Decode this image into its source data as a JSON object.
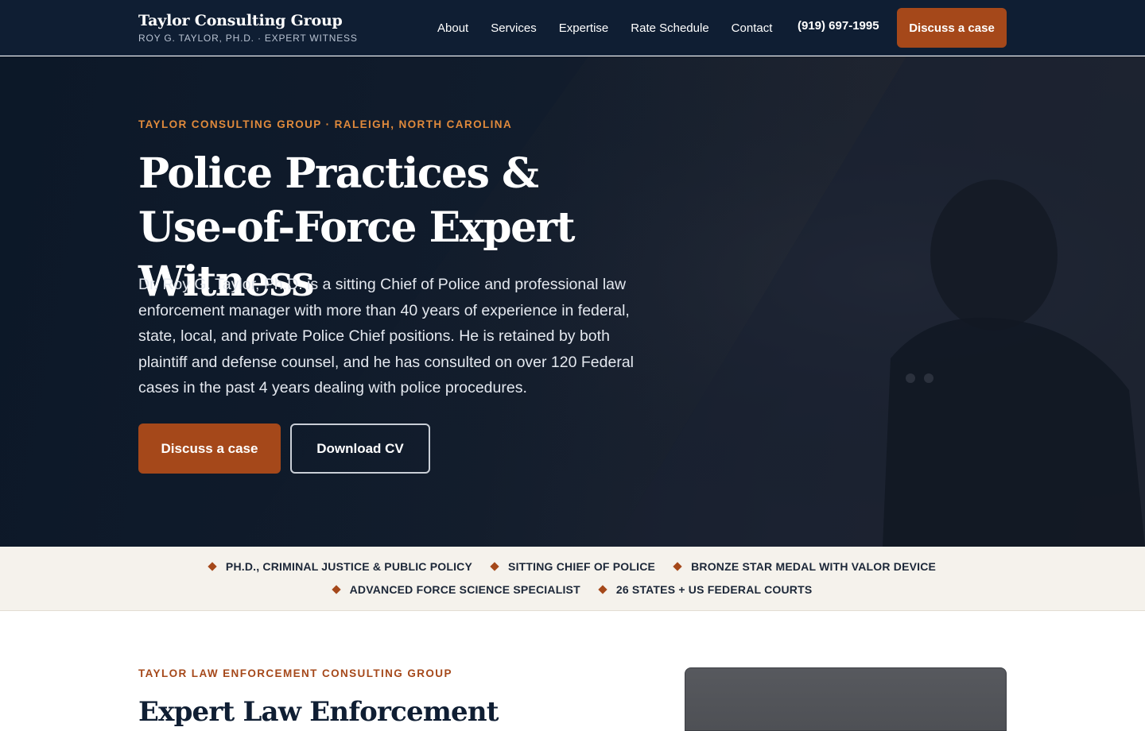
{
  "header": {
    "brand_name": "Taylor Consulting Group",
    "brand_sub": "ROY G. TAYLOR, PH.D. · EXPERT WITNESS",
    "nav": [
      "About",
      "Services",
      "Expertise",
      "Rate Schedule",
      "Contact"
    ],
    "phone": "(919) 697-1995",
    "cta_label": "Discuss a case"
  },
  "hero": {
    "eyebrow": "TAYLOR CONSULTING GROUP · RALEIGH, NORTH CAROLINA",
    "title": "Police Practices & Use-of-Force Expert Witness",
    "description": "Dr. Roy G. Taylor, Ph.D. is a sitting Chief of Police and professional law enforcement manager with more than 40 years of experience in federal, state, local, and private Police Chief positions. He is retained by both plaintiff and defense counsel, and he has consulted on over 120 Federal cases in the past 4 years dealing with police procedures.",
    "primary_cta": "Discuss a case",
    "secondary_cta": "Download CV"
  },
  "credentials": {
    "row1": [
      "PH.D., CRIMINAL JUSTICE & PUBLIC POLICY",
      "SITTING CHIEF OF POLICE",
      "BRONZE STAR MEDAL WITH VALOR DEVICE"
    ],
    "row2": [
      "ADVANCED FORCE SCIENCE SPECIALIST",
      "26 STATES + US FEDERAL COURTS"
    ]
  },
  "section": {
    "eyebrow": "TAYLOR LAW ENFORCEMENT CONSULTING GROUP",
    "title": "Expert Law Enforcement"
  },
  "colors": {
    "navy": "#0f1e33",
    "accent": "#a5481a",
    "eyebrow_orange": "#e08a3c",
    "cream": "#f5f2ec"
  }
}
